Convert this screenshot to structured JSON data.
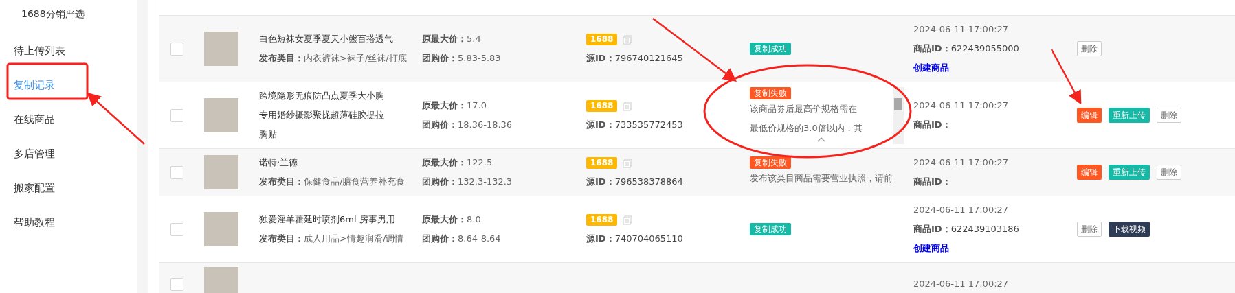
{
  "sidebar": {
    "title": "1688分销严选",
    "items": [
      {
        "label": "待上传列表",
        "selected": false
      },
      {
        "label": "复制记录",
        "selected": true
      },
      {
        "label": "在线商品",
        "selected": false
      },
      {
        "label": "多店管理",
        "selected": false
      },
      {
        "label": "搬家配置",
        "selected": false
      },
      {
        "label": "帮助教程",
        "selected": false
      }
    ]
  },
  "table": {
    "rows": [
      {
        "checked": false,
        "name_lines": [
          "白色短袜女夏季夏天小熊百搭透气"
        ],
        "category_label": "发布类目：",
        "category": "内衣裤袜>袜子/丝袜/打底",
        "max_price_label": "原最大价：",
        "max_price": "5.4",
        "group_price_label": "团购价：",
        "group_price": "5.83-5.83",
        "source_badge": "1688",
        "source_id_label": "源ID：",
        "source_id": "796740121645",
        "status": {
          "kind": "success",
          "label": "复制成功"
        },
        "time": "2024-06-11 17:00:27",
        "product_id_label": "商品ID：",
        "product_id": "622439055000",
        "create_link": "创建商品",
        "actions": [
          {
            "kind": "delete",
            "label": "删除"
          }
        ]
      },
      {
        "checked": false,
        "name_lines": [
          "跨境隐形无痕防凸点夏季大小胸",
          "专用婚纱摄影聚拢超薄硅胶提拉",
          "胸贴"
        ],
        "max_price_label": "原最大价：",
        "max_price": "17.0",
        "group_price_label": "团购价：",
        "group_price": "18.36-18.36",
        "source_badge": "1688",
        "source_id_label": "源ID：",
        "source_id": "733535772453",
        "status": {
          "kind": "failed",
          "label": "复制失败",
          "scroll": true,
          "message_lines": [
            "该商品券后最高价规格需在",
            "最低价规格的3.0倍以内，其"
          ]
        },
        "time": "2024-06-11 17:00:27",
        "product_id_label": "商品ID：",
        "actions": [
          {
            "kind": "edit",
            "label": "编辑"
          },
          {
            "kind": "reupload",
            "label": "重新上传"
          },
          {
            "kind": "delete",
            "label": "删除"
          }
        ]
      },
      {
        "checked": false,
        "name_lines": [
          "诺特·兰德"
        ],
        "category_label": "发布类目：",
        "category": "保健食品/膳食营养补充食",
        "max_price_label": "原最大价：",
        "max_price": "122.5",
        "group_price_label": "团购价：",
        "group_price": "132.3-132.3",
        "source_badge": "1688",
        "source_id_label": "源ID：",
        "source_id": "796538378864",
        "status": {
          "kind": "failed",
          "label": "复制失败",
          "message_lines": [
            "发布该类目商品需要营业执照，请前"
          ]
        },
        "time": "2024-06-11 17:00:27",
        "product_id_label": "商品ID：",
        "actions": [
          {
            "kind": "edit",
            "label": "编辑"
          },
          {
            "kind": "reupload",
            "label": "重新上传"
          },
          {
            "kind": "delete",
            "label": "删除"
          }
        ]
      },
      {
        "checked": false,
        "name_lines": [
          "独爱淫羊藿延时喷剂6ml 房事男用"
        ],
        "category_label": "发布类目：",
        "category": "成人用品>情趣润滑/调情",
        "max_price_label": "原最大价：",
        "max_price": "8.0",
        "group_price_label": "团购价：",
        "group_price": "8.64-8.64",
        "source_badge": "1688",
        "source_id_label": "源ID：",
        "source_id": "740704065110",
        "status": {
          "kind": "success",
          "label": "复制成功"
        },
        "time": "2024-06-11 17:00:27",
        "product_id_label": "商品ID：",
        "product_id": "622439103186",
        "create_link": "创建商品",
        "actions": [
          {
            "kind": "delete",
            "label": "删除"
          },
          {
            "kind": "download",
            "label": "下载视频"
          }
        ]
      },
      {
        "checked": false,
        "time": "2024-06-11 17:00:27"
      }
    ]
  }
}
